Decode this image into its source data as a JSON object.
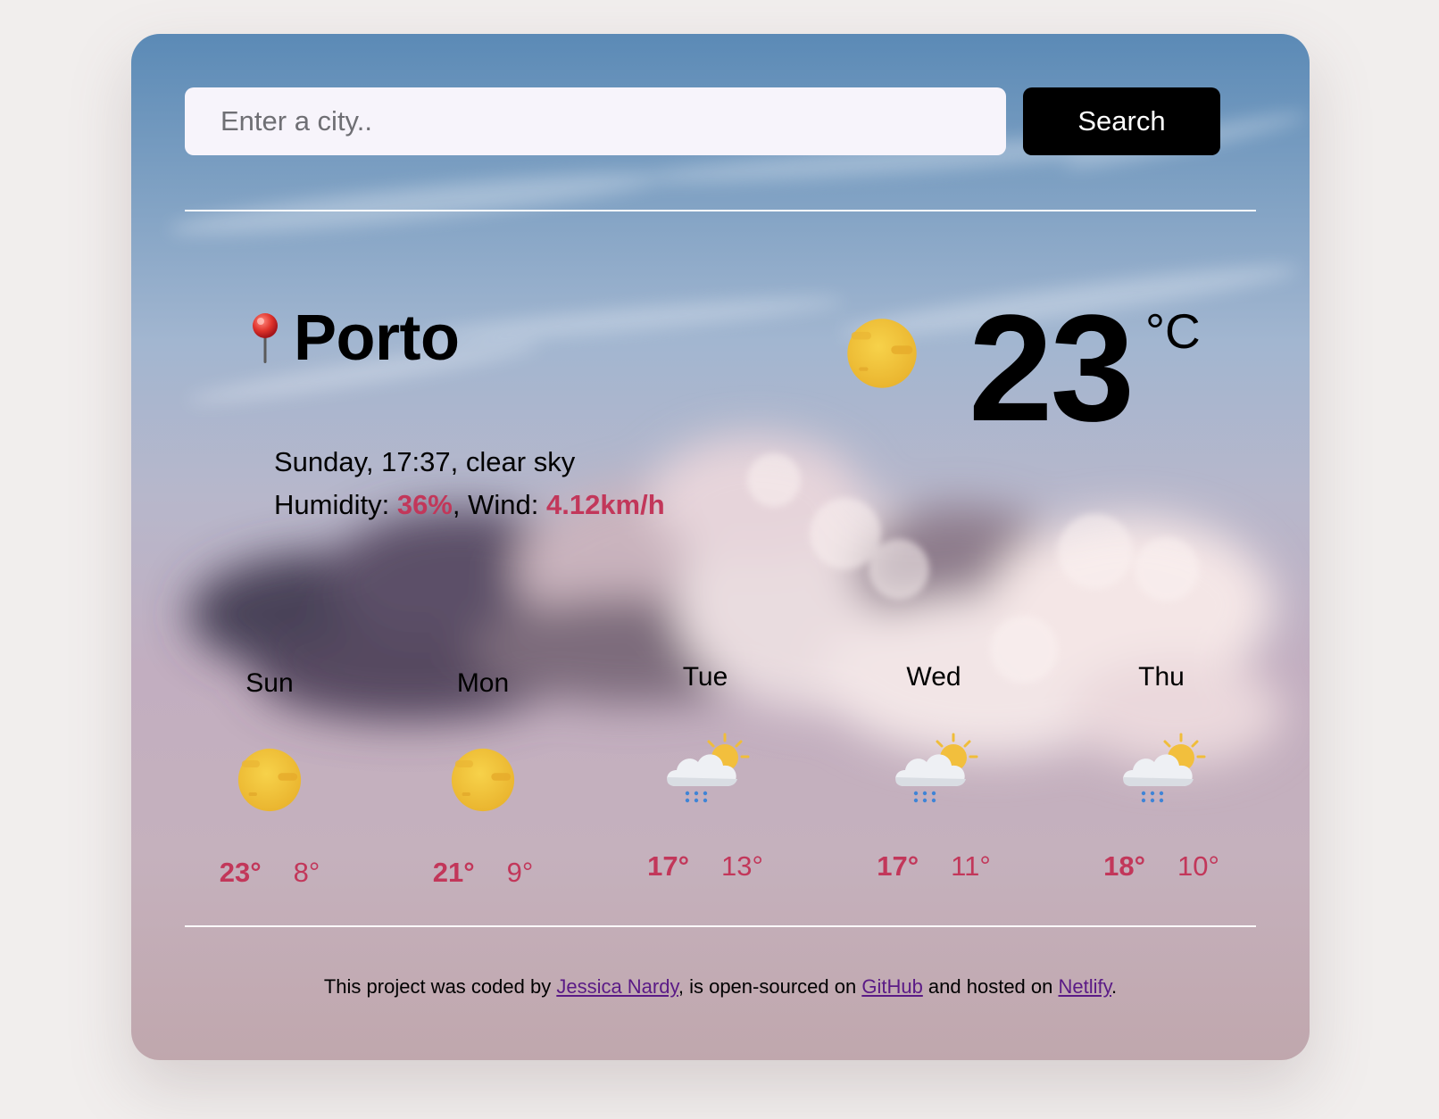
{
  "search": {
    "placeholder": "Enter a city..",
    "value": "",
    "button_label": "Search"
  },
  "current": {
    "city": "Porto",
    "day": "Sunday",
    "time": "17:37",
    "description": "clear sky",
    "humidity_label": "Humidity:",
    "humidity": "36%",
    "wind_label": "Wind:",
    "wind": "4.12km/h",
    "temperature": "23",
    "unit": "°C",
    "icon": "sun-icon",
    "location_icon": "pushpin-icon"
  },
  "forecast": [
    {
      "day": "Sun",
      "icon": "sun-icon",
      "max": "23°",
      "min": "8°"
    },
    {
      "day": "Mon",
      "icon": "sun-icon",
      "max": "21°",
      "min": "9°"
    },
    {
      "day": "Tue",
      "icon": "sun-cloud-rain-icon",
      "max": "17°",
      "min": "13°"
    },
    {
      "day": "Wed",
      "icon": "sun-cloud-rain-icon",
      "max": "17°",
      "min": "11°"
    },
    {
      "day": "Thu",
      "icon": "sun-cloud-rain-icon",
      "max": "18°",
      "min": "10°"
    }
  ],
  "footer": {
    "text_1": "This project was coded by ",
    "author": "Jessica Nardy",
    "text_2": ", is open-sourced on ",
    "github": "GitHub",
    "text_3": " and hosted on ",
    "netlify": "Netlify",
    "text_4": "."
  },
  "colors": {
    "accent": "#c2375a",
    "button": "#000000",
    "link": "#5a1a86",
    "page_bg": "#f1eeed"
  }
}
